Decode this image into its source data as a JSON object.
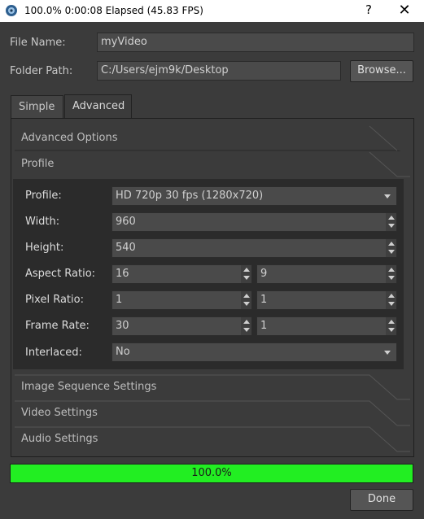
{
  "window": {
    "title": "100.0%  0:00:08 Elapsed (45.83 FPS)",
    "help_glyph": "?",
    "close_glyph": "✕"
  },
  "file": {
    "name_label": "File Name:",
    "name_value": "myVideo",
    "folder_label": "Folder Path:",
    "folder_value": "C:/Users/ejm9k/Desktop",
    "browse_label": "Browse..."
  },
  "tabs": [
    {
      "label": "Simple",
      "active": false
    },
    {
      "label": "Advanced",
      "active": true
    }
  ],
  "sections": {
    "advanced_options": "Advanced Options",
    "profile": "Profile",
    "image_sequence": "Image Sequence Settings",
    "video": "Video Settings",
    "audio": "Audio Settings"
  },
  "profile": {
    "profile_label": "Profile:",
    "profile_value": "HD 720p 30 fps (1280x720)",
    "width_label": "Width:",
    "width_value": "960",
    "height_label": "Height:",
    "height_value": "540",
    "aspect_label": "Aspect Ratio:",
    "aspect_num": "16",
    "aspect_den": "9",
    "pixel_label": "Pixel Ratio:",
    "pixel_num": "1",
    "pixel_den": "1",
    "frame_label": "Frame Rate:",
    "frame_num": "30",
    "frame_den": "1",
    "interlaced_label": "Interlaced:",
    "interlaced_value": "No"
  },
  "progress": {
    "text": "100.0%",
    "value": 1.0,
    "color": "#22ee22"
  },
  "done_label": "Done"
}
